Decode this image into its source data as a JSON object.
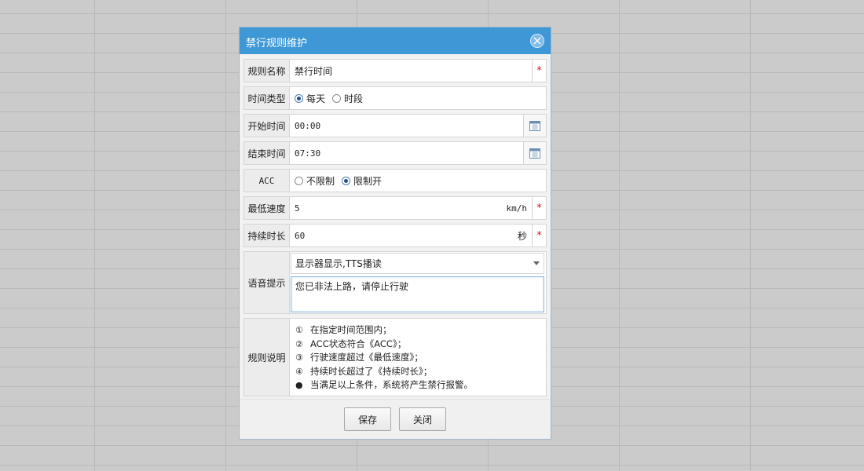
{
  "dialog": {
    "title": "禁行规则维护"
  },
  "form": {
    "rule_name": {
      "label": "规则名称",
      "value": "禁行时间"
    },
    "time_type": {
      "label": "时间类型",
      "options": [
        "每天",
        "时段"
      ],
      "selected": "每天"
    },
    "start_time": {
      "label": "开始时间",
      "value": "00:00"
    },
    "end_time": {
      "label": "结束时间",
      "value": "07:30"
    },
    "acc": {
      "label": "ACC",
      "options": [
        "不限制",
        "限制开"
      ],
      "selected": "限制开"
    },
    "min_speed": {
      "label": "最低速度",
      "value": "5",
      "unit": "km/h"
    },
    "duration": {
      "label": "持续时长",
      "value": "60",
      "unit": "秒"
    },
    "voice": {
      "label": "语音提示",
      "select_value": "显示器显示,TTS播读",
      "text": "您已非法上路，请停止行驶"
    },
    "description": {
      "label": "规则说明",
      "lines": [
        {
          "marker": "①",
          "text": "在指定时间范围内；"
        },
        {
          "marker": "②",
          "text": "ACC状态符合《ACC》；"
        },
        {
          "marker": "③",
          "text": "行驶速度超过《最低速度》；"
        },
        {
          "marker": "④",
          "text": "持续时长超过了《持续时长》；"
        },
        {
          "marker": "●",
          "text": "当满足以上条件，系统将产生禁行报警。"
        }
      ]
    },
    "required_mark": "*"
  },
  "buttons": {
    "save": "保存",
    "close": "关闭"
  },
  "colors": {
    "titlebar": "#3f98d6",
    "required": "#d2141e"
  }
}
